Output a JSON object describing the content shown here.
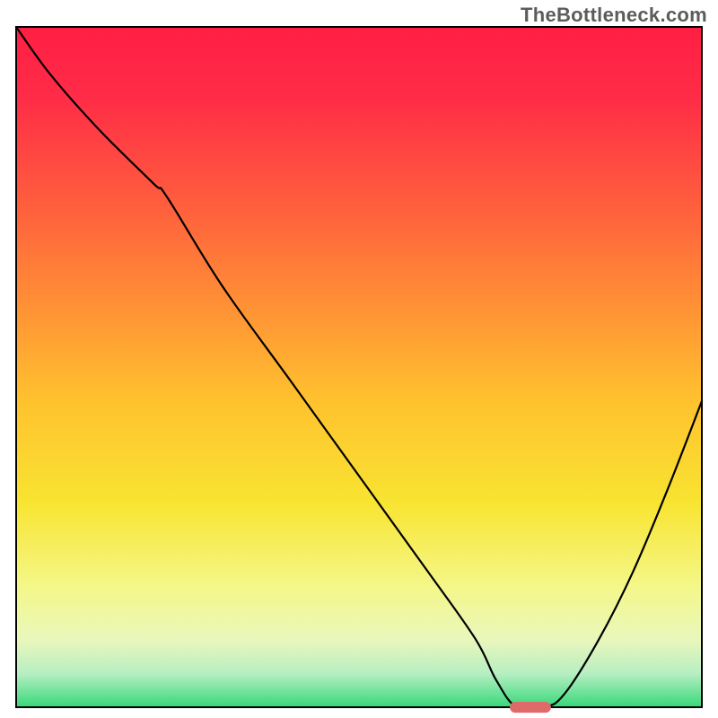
{
  "watermark": "TheBottleneck.com",
  "chart_data": {
    "type": "line",
    "title": "",
    "xlabel": "",
    "ylabel": "",
    "xlim": [
      0,
      100
    ],
    "ylim": [
      0,
      100
    ],
    "axes_visible": false,
    "grid": false,
    "background": {
      "type": "vertical-gradient",
      "stops": [
        {
          "offset": 0.0,
          "color": "#ff1f44"
        },
        {
          "offset": 0.1,
          "color": "#ff2b47"
        },
        {
          "offset": 0.25,
          "color": "#ff5a3e"
        },
        {
          "offset": 0.4,
          "color": "#ff8d36"
        },
        {
          "offset": 0.55,
          "color": "#ffc22e"
        },
        {
          "offset": 0.7,
          "color": "#f8e431"
        },
        {
          "offset": 0.82,
          "color": "#f4f787"
        },
        {
          "offset": 0.9,
          "color": "#eaf7bc"
        },
        {
          "offset": 0.95,
          "color": "#b7efc2"
        },
        {
          "offset": 1.0,
          "color": "#37d879"
        }
      ]
    },
    "series": [
      {
        "name": "bottleneck-curve",
        "stroke": "#000000",
        "stroke_width": 2.2,
        "x": [
          0,
          5,
          12,
          20,
          22,
          30,
          40,
          50,
          60,
          67,
          70,
          73,
          77,
          80,
          85,
          90,
          95,
          100
        ],
        "y": [
          100,
          93,
          85,
          77,
          75,
          62,
          48,
          34,
          20,
          10,
          4,
          0,
          0,
          2,
          10,
          20,
          32,
          45
        ]
      }
    ],
    "markers": [
      {
        "name": "optimal-marker",
        "shape": "rounded-bar",
        "x": 75,
        "y": 0,
        "width_pct": 6.0,
        "height_pct": 1.6,
        "fill": "#e06a6a",
        "corner_radius": 6
      }
    ]
  }
}
